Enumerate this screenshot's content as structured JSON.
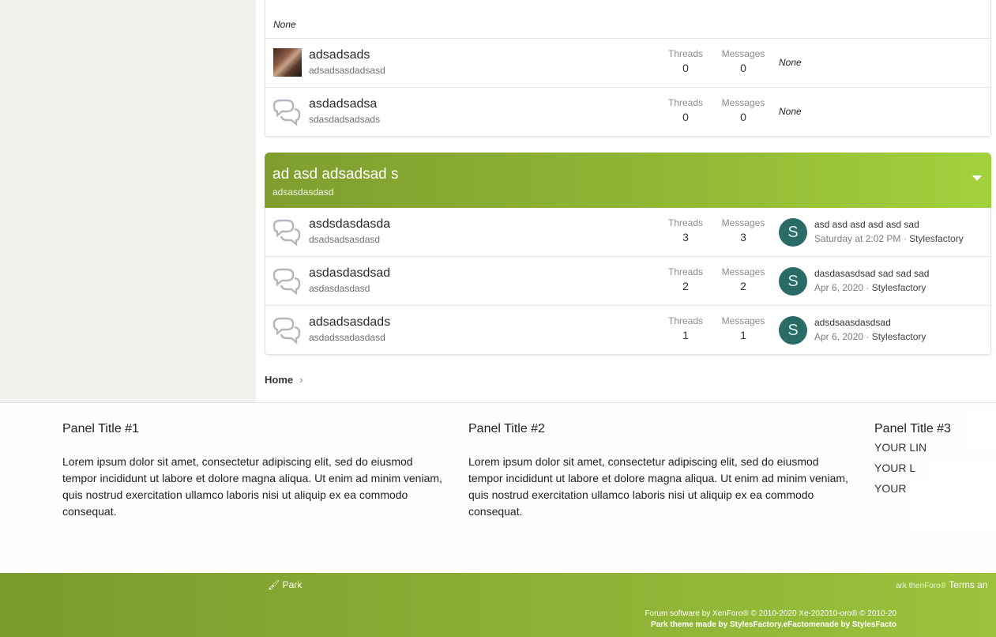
{
  "top_block": {
    "none_label": "None",
    "nodes": [
      {
        "title": "adsadsads",
        "desc": "adsadsasdadsasd",
        "threads_label": "Threads",
        "threads": "0",
        "messages_label": "Messages",
        "messages": "0",
        "last": "None"
      },
      {
        "title": "asdadsadsa",
        "desc": "sdasdadsadsads",
        "threads_label": "Threads",
        "threads": "0",
        "messages_label": "Messages",
        "messages": "0",
        "last": "None"
      }
    ]
  },
  "category": {
    "title": "ad asd adsadsad s",
    "desc": "adsasdasdasd",
    "nodes": [
      {
        "title": "asdsdasdasda",
        "desc": "dsadsadsasdasd",
        "threads_label": "Threads",
        "threads": "3",
        "messages_label": "Messages",
        "messages": "3",
        "avatar": "S",
        "last_title": "asd asd asd asd asd sad",
        "last_date": "Saturday at 2:02 PM",
        "last_user": "Stylesfactory"
      },
      {
        "title": "asdasdasdsad",
        "desc": "asdasdasdasd",
        "threads_label": "Threads",
        "threads": "2",
        "messages_label": "Messages",
        "messages": "2",
        "avatar": "S",
        "last_title": "dasdasasdsad sad sad sad",
        "last_date": "Apr 6, 2020",
        "last_user": "Stylesfactory"
      },
      {
        "title": "adsadsasdads",
        "desc": "asdadssadasdasd",
        "threads_label": "Threads",
        "threads": "1",
        "messages_label": "Messages",
        "messages": "1",
        "avatar": "S",
        "last_title": "adsdsaasdasdsad",
        "last_date": "Apr 6, 2020",
        "last_user": "Stylesfactory"
      }
    ]
  },
  "breadcrumb": {
    "home": "Home",
    "chevron": "›"
  },
  "panels": [
    {
      "title": "Panel Title #1",
      "text": "Lorem ipsum dolor sit amet, consectetur adipiscing elit, sed do eiusmod tempor incididunt ut labore et dolore magna aliqua. Ut enim ad minim veniam, quis nostrud exercitation ullamco laboris nisi ut aliquip ex ea commodo consequat."
    },
    {
      "title": "Panel Title #2",
      "text": "Lorem ipsum dolor sit amet, consectetur adipiscing elit, sed do eiusmod tempor incididunt ut labore et dolore magna aliqua. Ut enim ad minim veniam, quis nostrud exercitation ullamco laboris nisi ut aliquip ex ea commodo consequat."
    },
    {
      "title": "Panel Title #3",
      "links": [
        "YOUR LIN",
        "YOUR L",
        "YOUR"
      ]
    }
  ],
  "footer": {
    "park": "Park",
    "terms_small": "ark thenForo®",
    "terms": "Terms an",
    "copyright": "Forum software by XenForo® © 2010-2020 Xe-202010-oro® © 2010-20",
    "credit": "Park theme made by StylesFactory.eFactomenade by StylesFacto"
  },
  "colors": {
    "accent": "#8fb434",
    "avatar": "#2a6b66"
  }
}
